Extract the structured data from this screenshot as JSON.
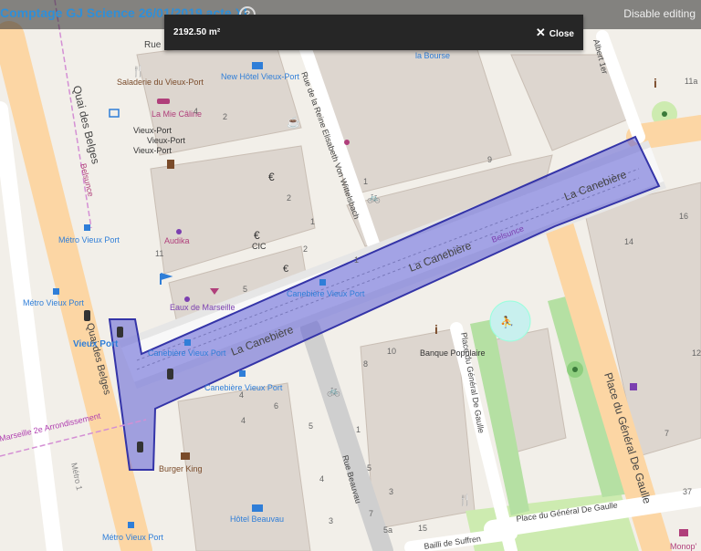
{
  "header": {
    "title": "Comptage GJ Science 26/01/2019 acte XI",
    "help": "?",
    "disable_editing": "Disable editing"
  },
  "measure": {
    "area": "2192.50 m²",
    "close_label": "Close"
  },
  "map": {
    "streets": {
      "quai_des_belges": "Quai des Belges",
      "quai_des_belges_2": "Quai des Belges",
      "canebiere_1": "La Canebière",
      "canebiere_2": "La Canebière",
      "canebiere_3": "La Canebière",
      "reine_elisabeth": "Rue de la Reine Elisabeth Von Wittelsbach",
      "general_de_gaulle_place": "Place du Général De Gaulle",
      "general_de_gaulle_place_2": "Place du Général De Gaulle",
      "general_de_gaulle_vertical": "Place du Général De Gaulle",
      "rue_beauvau": "Rue Beauvau",
      "bailli_de_suffren": "Bailli de Suffren",
      "albert_1er": "Albert 1er",
      "belsunce_1": "Belsunce",
      "belsunce_2": "Belsunce",
      "metro_1": "Métro 1",
      "marseille_2e": "Marseille 2e Arrondissement",
      "rue_top": "Rue"
    },
    "pois": {
      "new_hotel": "New Hôtel Vieux-Port",
      "saladerie": "Saladerie du Vieux-Port",
      "la_mie_caline": "La Mie Câline",
      "vieux_port_x3": [
        "Vieux-Port",
        "Vieux-Port",
        "Vieux-Port"
      ],
      "audika": "Audika",
      "cic": "CIC",
      "eaux_de_marseille": "Eaux de Marseille",
      "vieux_port_label": "Vieux Port",
      "metro_vieux_port_1": "Métro Vieux Port",
      "metro_vieux_port_2": "Métro Vieux Port",
      "metro_vieux_port_3": "Métro Vieux Port",
      "canebiere_vieux_port_1": "Canebière Vieux Port",
      "canebiere_vieux_port_2": "Canebière Vieux Port",
      "canebiere_vieux_port_3": "Canebière Vieux Port",
      "banque_populaire": "Banque Populaire",
      "burger_king": "Burger King",
      "hotel_beauvau": "Hôtel Beauvau",
      "la_bourse": "la Bourse",
      "monop": "Monop'"
    },
    "numbers": [
      "11a",
      "16",
      "14",
      "12",
      "9",
      "10",
      "8",
      "1",
      "6",
      "4",
      "2",
      "4",
      "5",
      "1",
      "3",
      "5",
      "7",
      "11",
      "5a",
      "15",
      "37",
      "4",
      "2",
      "1",
      "2",
      "1",
      "5",
      "3",
      "4",
      "7"
    ]
  },
  "colors": {
    "measure_fill": "#5c5cd6",
    "measure_stroke": "#3434a8",
    "title": "#2f8fd8",
    "road_primary": "#fcd6a4",
    "building": "#d9d0c9",
    "park": "#b5e0a3"
  }
}
